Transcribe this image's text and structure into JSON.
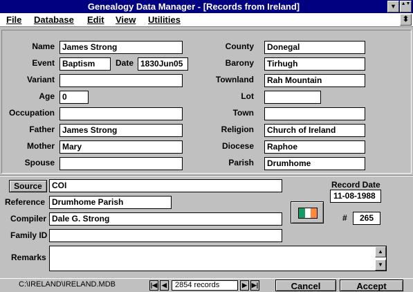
{
  "window": {
    "title": "Genealogy Data Manager - [Records from Ireland]",
    "min_glyph": "▼",
    "restore_glyph": "▲▼",
    "menu_restore_glyph": "⬍"
  },
  "menu": {
    "file": "File",
    "database": "Database",
    "edit": "Edit",
    "view": "View",
    "utilities": "Utilities"
  },
  "record": {
    "name_label": "Name",
    "name": "James Strong",
    "event_label": "Event",
    "event": "Baptism",
    "date_label": "Date",
    "date": "1830Jun05",
    "variant_label": "Variant",
    "variant": "",
    "age_label": "Age",
    "age": "0",
    "occupation_label": "Occupation",
    "occupation": "",
    "father_label": "Father",
    "father": "James Strong",
    "mother_label": "Mother",
    "mother": "Mary",
    "spouse_label": "Spouse",
    "spouse": "",
    "county_label": "County",
    "county": "Donegal",
    "barony_label": "Barony",
    "barony": "Tirhugh",
    "townland_label": "Townland",
    "townland": "Rah Mountain",
    "lot_label": "Lot",
    "lot": "",
    "town_label": "Town",
    "town": "",
    "religion_label": "Religion",
    "religion": "Church of Ireland",
    "diocese_label": "Diocese",
    "diocese": "Raphoe",
    "parish_label": "Parish",
    "parish": "Drumhome"
  },
  "source": {
    "source_button": "Source",
    "source": "COI",
    "reference_label": "Reference",
    "reference": "Drumhome Parish",
    "compiler_label": "Compiler",
    "compiler": "Dale G. Strong",
    "family_label": "Family ID",
    "family_id": "",
    "remarks_label": "Remarks",
    "remarks": "",
    "record_date_label": "Record Date",
    "record_date": "11-08-1988",
    "number_label": "#",
    "number": "265",
    "flag_colors": [
      "#169b62",
      "#ffffff",
      "#ff883e"
    ]
  },
  "status": {
    "path": "C:\\IRELAND\\IRELAND.MDB",
    "records": "2854 records",
    "cancel": "Cancel",
    "accept": "Accept"
  }
}
